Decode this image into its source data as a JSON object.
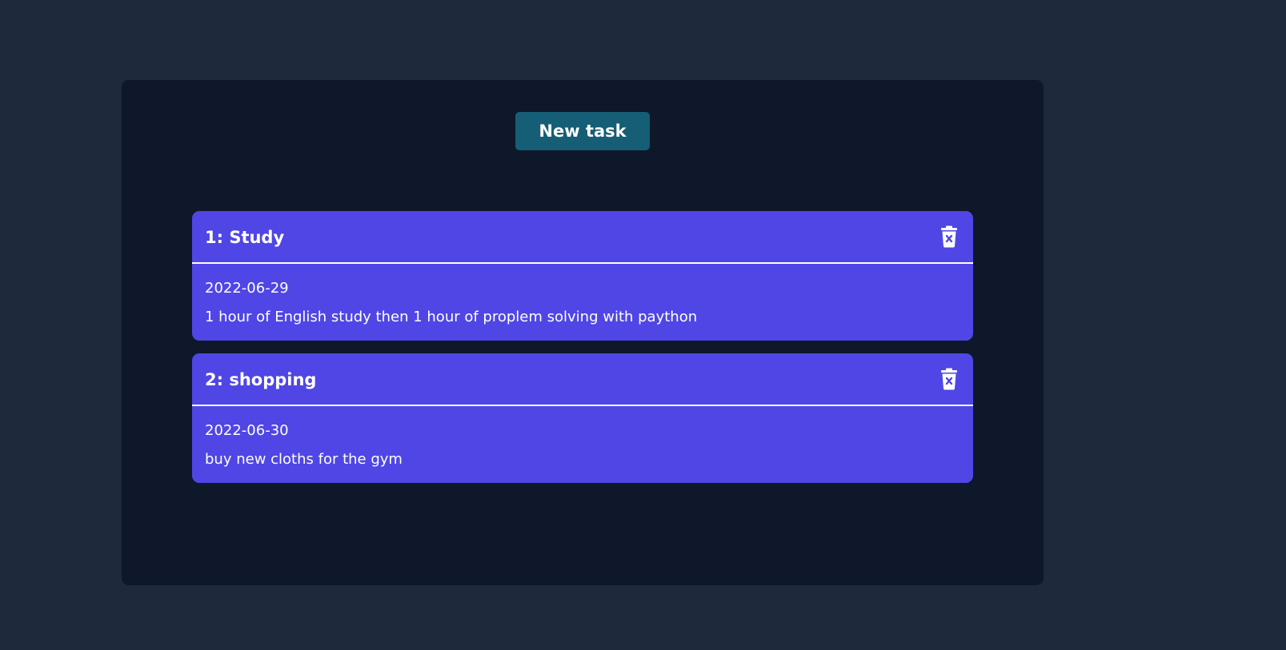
{
  "toolbar": {
    "new_task_label": "New task"
  },
  "tasks": [
    {
      "title": "1: Study",
      "date": "2022-06-29",
      "description": "1 hour of English study then 1 hour of proplem solving with paython",
      "delete_icon": "trash-x-icon"
    },
    {
      "title": "2: shopping",
      "date": "2022-06-30",
      "description": "buy new cloths for the gym",
      "delete_icon": "trash-x-icon"
    }
  ],
  "colors": {
    "page_background": "#1e293b",
    "panel_background": "#0f172a",
    "button_background": "#155e75",
    "card_background": "#4f46e5",
    "text": "#ffffff"
  }
}
